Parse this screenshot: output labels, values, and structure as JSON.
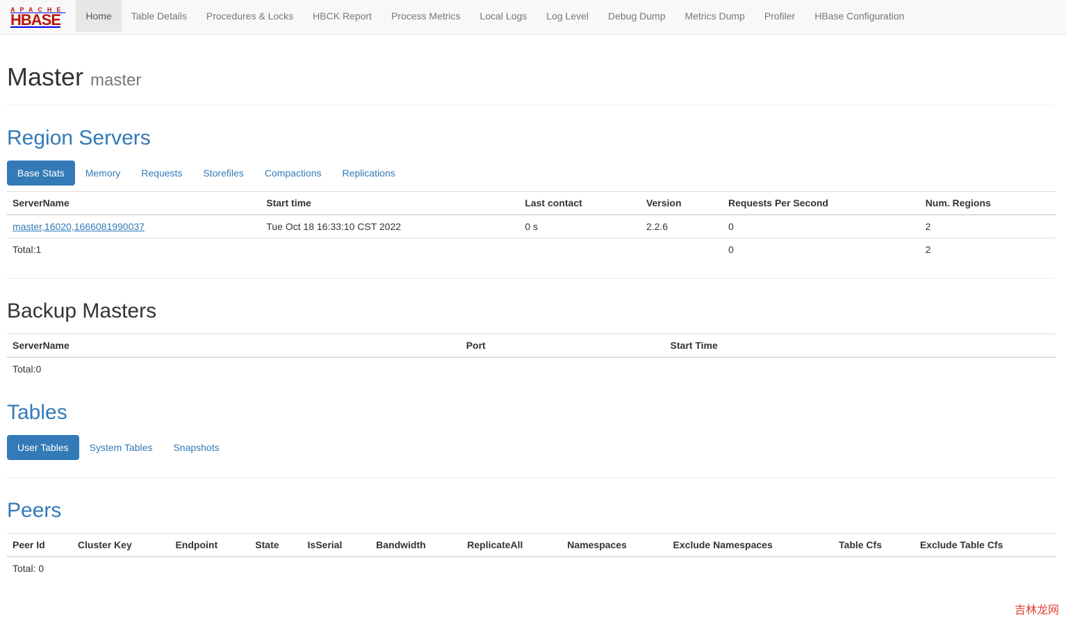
{
  "brand": {
    "top": "APACHE",
    "bottom": "HBASE"
  },
  "nav": [
    {
      "label": "Home",
      "active": true
    },
    {
      "label": "Table Details"
    },
    {
      "label": "Procedures & Locks"
    },
    {
      "label": "HBCK Report"
    },
    {
      "label": "Process Metrics"
    },
    {
      "label": "Local Logs"
    },
    {
      "label": "Log Level"
    },
    {
      "label": "Debug Dump"
    },
    {
      "label": "Metrics Dump"
    },
    {
      "label": "Profiler"
    },
    {
      "label": "HBase Configuration"
    }
  ],
  "page_title": "Master",
  "page_subtitle": "master",
  "region_servers": {
    "heading": "Region Servers",
    "tabs": [
      {
        "label": "Base Stats",
        "active": true
      },
      {
        "label": "Memory"
      },
      {
        "label": "Requests"
      },
      {
        "label": "Storefiles"
      },
      {
        "label": "Compactions"
      },
      {
        "label": "Replications"
      }
    ],
    "columns": [
      "ServerName",
      "Start time",
      "Last contact",
      "Version",
      "Requests Per Second",
      "Num. Regions"
    ],
    "rows": [
      {
        "server": "master,16020,1666081990037",
        "start": "Tue Oct 18 16:33:10 CST 2022",
        "last": "0 s",
        "version": "2.2.6",
        "rps": "0",
        "regions": "2"
      }
    ],
    "total_row": {
      "label": "Total:1",
      "rps": "0",
      "regions": "2"
    }
  },
  "backup_masters": {
    "heading": "Backup Masters",
    "columns": [
      "ServerName",
      "Port",
      "Start Time"
    ],
    "total": "Total:0"
  },
  "tables": {
    "heading": "Tables",
    "tabs": [
      {
        "label": "User Tables",
        "active": true
      },
      {
        "label": "System Tables"
      },
      {
        "label": "Snapshots"
      }
    ]
  },
  "peers": {
    "heading": "Peers",
    "columns": [
      "Peer Id",
      "Cluster Key",
      "Endpoint",
      "State",
      "IsSerial",
      "Bandwidth",
      "ReplicateAll",
      "Namespaces",
      "Exclude Namespaces",
      "Table Cfs",
      "Exclude Table Cfs"
    ],
    "total": "Total: 0"
  },
  "watermark": "吉林龙网"
}
